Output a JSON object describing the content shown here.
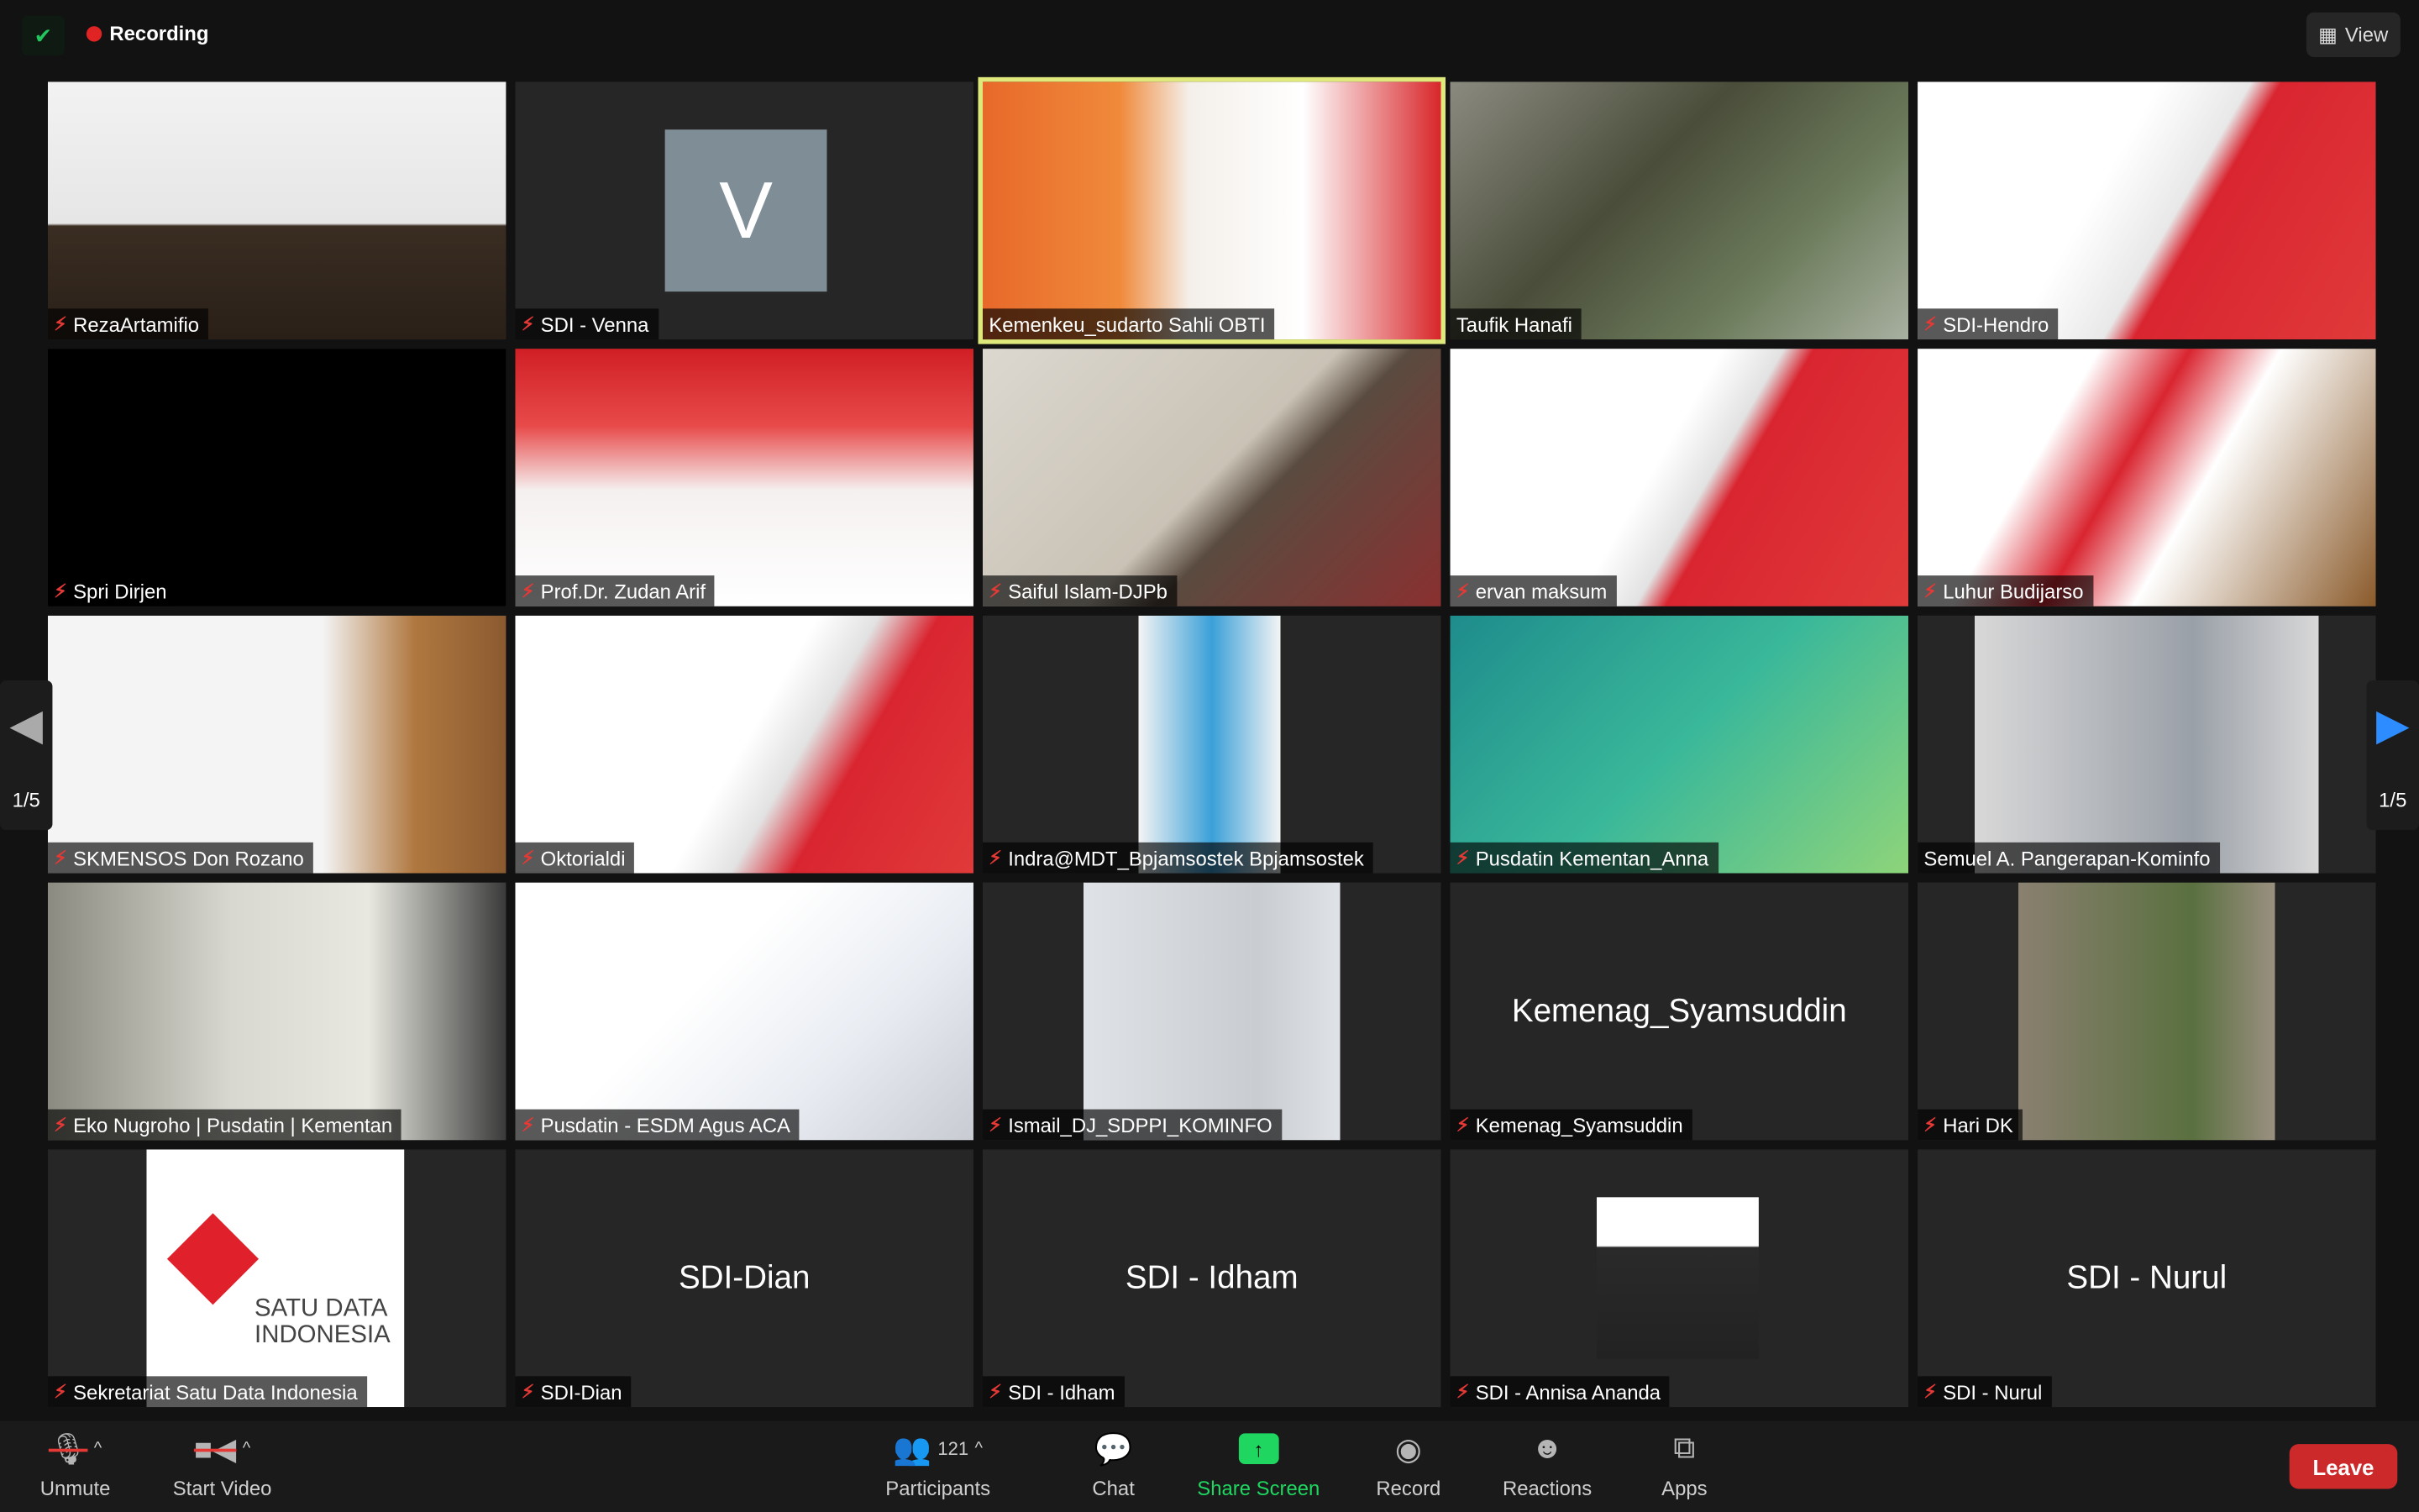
{
  "topbar": {
    "recording_label": "Recording",
    "view_label": "View"
  },
  "pager": {
    "left": "1/5",
    "right": "1/5"
  },
  "tiles": [
    {
      "name": "RezaArtamifio",
      "muted": true,
      "kind": "video",
      "bg": "linear-gradient(180deg,#f2f2f2,#e6e6e6 55%,#3a2d22 56%,#2a2018)"
    },
    {
      "name": "SDI - Venna",
      "muted": true,
      "kind": "avatar",
      "initial": "V"
    },
    {
      "name": "Kemenkeu_sudarto Sahli OBTI",
      "muted": false,
      "kind": "video",
      "active": true,
      "bg": "linear-gradient(90deg,#e8692a 0%,#f08a3b 30%,#f4efe9 45%,#fff 70%,#d8262a 100%)"
    },
    {
      "name": "Taufik Hanafi",
      "muted": false,
      "kind": "video",
      "bg": "linear-gradient(135deg,#8b8a80,#4a4d3a 40%,#6b7a5a 70%,#a8b0a0)"
    },
    {
      "name": "SDI-Hendro",
      "muted": true,
      "kind": "video",
      "bg": "linear-gradient(120deg,#fff 40%,#e8e8e8 55%,#d92530 60%,#e03a3a)"
    },
    {
      "name": "Spri Dirjen",
      "muted": true,
      "kind": "video",
      "bg": "#000"
    },
    {
      "name": "Prof.Dr. Zudan Arif",
      "muted": true,
      "kind": "video",
      "bg": "linear-gradient(180deg,#d01f25 0%,#e84a4a 30%,#f5f0f0 55%,#fff 100%)"
    },
    {
      "name": "Saiful Islam-DJPb",
      "muted": true,
      "kind": "video",
      "bg": "linear-gradient(135deg,#dcd8d0,#c9c2b5 50%,#5a4b40 60%,#8a3030)"
    },
    {
      "name": "ervan maksum",
      "muted": true,
      "kind": "video",
      "bg": "linear-gradient(120deg,#fff 45%,#e2e2e2 55%,#d92530 60%,#e03a3a)"
    },
    {
      "name": "Luhur Budijarso",
      "muted": true,
      "kind": "video",
      "bg": "linear-gradient(120deg,#fff 30%,#d92530 45%,#fff 60%,#8a5a2a)"
    },
    {
      "name": "SKMENSOS Don Rozano",
      "muted": true,
      "kind": "video",
      "bg": "linear-gradient(90deg,#f4f4f4 60%,#b07840 80%,#8a5a30)"
    },
    {
      "name": "Oktorialdi",
      "muted": true,
      "kind": "video",
      "bg": "linear-gradient(120deg,#fff 50%,#e2e2e2 60%,#d92530 70%,#e03a3a)"
    },
    {
      "name": "Indra@MDT_Bpjamsostek Bpjamsostek",
      "muted": true,
      "kind": "video",
      "bg": "linear-gradient(90deg,#262626 34%,#f4f4f4 34%,#3aa0d8 50%,#f4f4f4 65%,#262626 65%)"
    },
    {
      "name": "Pusdatin Kementan_Anna",
      "muted": true,
      "kind": "video",
      "bg": "linear-gradient(135deg,#1e8c8c,#3ab89a 50%,#8ed47a)"
    },
    {
      "name": "Semuel A. Pangerapan-Kominfo",
      "muted": false,
      "kind": "video",
      "bg": "linear-gradient(90deg,#262626 0%,#262626 12.5%,#d8d8d8 12.5%,#9aa0a8 60%,#d8d8d8 87.5%,#262626 87.5%)"
    },
    {
      "name": "Eko Nugroho | Pusdatin | Kementan",
      "muted": true,
      "kind": "video",
      "bg": "linear-gradient(90deg,#8a8a80,#d8d8d0 40%,#e8e8e0 70%,#3a3a3a)"
    },
    {
      "name": "Pusdatin - ESDM Agus ACA",
      "muted": true,
      "kind": "video",
      "bg": "linear-gradient(135deg,#fff 40%,#e8ecf2 70%,#c8ccd2)"
    },
    {
      "name": "Ismail_DJ_SDPPI_KOMINFO",
      "muted": true,
      "kind": "video",
      "bg": "linear-gradient(90deg,#262626 22%,#dfe2e6 22%,#c9ccd0 60%,#dfe2e6 78%,#262626 78%)"
    },
    {
      "name": "Kemenag_Syamsuddin",
      "muted": true,
      "kind": "name",
      "big": "Kemenag_Syamsuddin"
    },
    {
      "name": "Hari DK",
      "muted": true,
      "kind": "video",
      "bg": "linear-gradient(90deg,#262626 22%,#8a8070 22%,#5a7040 60%,#9a9080 78%,#262626 78%)"
    },
    {
      "name": "Sekretariat Satu Data Indonesia",
      "muted": true,
      "kind": "logo",
      "logo_text": "SATU DATA INDONESIA"
    },
    {
      "name": "SDI-Dian",
      "muted": true,
      "kind": "name",
      "big": "SDI-Dian"
    },
    {
      "name": "SDI - Idham",
      "muted": true,
      "kind": "name",
      "big": "SDI - Idham"
    },
    {
      "name": "SDI - Annisa Ananda",
      "muted": true,
      "kind": "photo"
    },
    {
      "name": "SDI - Nurul",
      "muted": true,
      "kind": "name",
      "big": "SDI - Nurul"
    }
  ],
  "toolbar": {
    "unmute": "Unmute",
    "start_video": "Start Video",
    "participants": "Participants",
    "participant_count": "121",
    "chat": "Chat",
    "share_screen": "Share Screen",
    "record": "Record",
    "reactions": "Reactions",
    "apps": "Apps",
    "leave": "Leave"
  },
  "colors": {
    "share_green": "#1fd660",
    "leave_red": "#cc2a2a",
    "active_speaker": "#dfe87a",
    "muted_red": "#e53935"
  }
}
